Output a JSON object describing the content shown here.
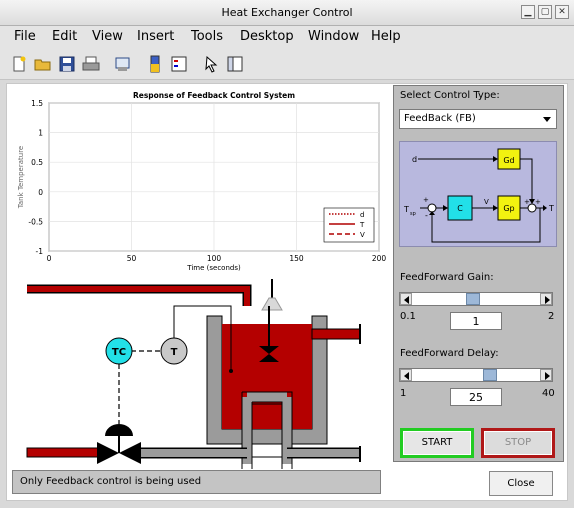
{
  "window": {
    "title": "Heat Exchanger Control"
  },
  "menu": [
    "File",
    "Edit",
    "View",
    "Insert",
    "Tools",
    "Desktop",
    "Window",
    "Help"
  ],
  "chart_data": {
    "type": "line",
    "title": "Response of Feedback Control System",
    "xlabel": "Time (seconds)",
    "ylabel": "Tank Temperature",
    "xlim": [
      0,
      200
    ],
    "ylim": [
      -1,
      1.5
    ],
    "xticks": [
      "0",
      "50",
      "100",
      "150",
      "200"
    ],
    "yticks": [
      "1.5",
      "1",
      "0.5",
      "0",
      "-0.5",
      "-1"
    ],
    "grid": true,
    "legend_placement": "bottom-right",
    "series": [
      {
        "name": "d",
        "color": "#b00000",
        "style": "dotted",
        "x": [],
        "y": []
      },
      {
        "name": "T",
        "color": "#b00000",
        "style": "solid",
        "x": [],
        "y": []
      },
      {
        "name": "V",
        "color": "#b00000",
        "style": "dashed",
        "x": [],
        "y": []
      }
    ]
  },
  "process": {
    "tc_label": "TC",
    "t_label": "T"
  },
  "panel": {
    "select_label": "Select Control Type:",
    "control_type": "FeedBack (FB)",
    "diagram": {
      "d": "d",
      "gd": "Gd",
      "t_sp": "T",
      "t_sp_sub": "sp",
      "c": "C",
      "v": "V",
      "gp": "Gp",
      "t_out": "T",
      "plus1": "+",
      "minus1": "-",
      "plus2": "+",
      "plus3": "+"
    },
    "ff_gain": {
      "label": "FeedForward Gain:",
      "min": "0.1",
      "max": "2",
      "value": "1",
      "fraction": 0.47
    },
    "ff_delay": {
      "label": "FeedForward Delay:",
      "min": "1",
      "max": "40",
      "value": "25",
      "fraction": 0.62
    },
    "start_label": "START",
    "stop_label": "STOP"
  },
  "status_text": "Only Feedback control is being used",
  "close_label": "Close"
}
